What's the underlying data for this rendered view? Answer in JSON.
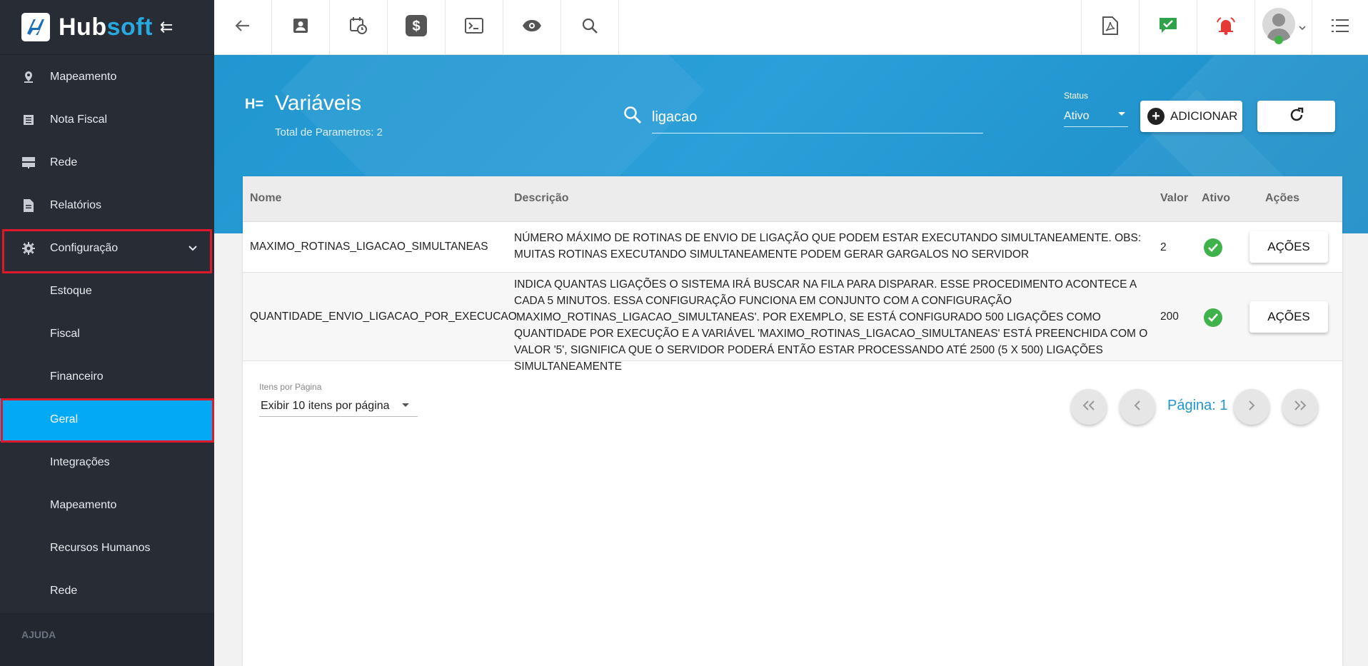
{
  "brand": {
    "name_part1": "Hub",
    "name_part2": "soft"
  },
  "sidebar": {
    "items": [
      {
        "label": "Mapeamento",
        "icon": "map-pin-icon"
      },
      {
        "label": "Nota Fiscal",
        "icon": "receipt-icon"
      },
      {
        "label": "Rede",
        "icon": "server-icon"
      },
      {
        "label": "Relatórios",
        "icon": "document-icon"
      },
      {
        "label": "Configuração",
        "icon": "gear-icon"
      }
    ],
    "subitems": [
      {
        "label": "Estoque"
      },
      {
        "label": "Fiscal"
      },
      {
        "label": "Financeiro"
      },
      {
        "label": "Geral"
      },
      {
        "label": "Integrações"
      },
      {
        "label": "Mapeamento"
      },
      {
        "label": "Recursos Humanos"
      },
      {
        "label": "Rede"
      }
    ],
    "help_label": "AJUDA"
  },
  "page": {
    "title": "Variáveis",
    "subtitle": "Total de Parametros: 2"
  },
  "search": {
    "value": "ligacao"
  },
  "status": {
    "label": "Status",
    "value": "Ativo"
  },
  "buttons": {
    "add": "ADICIONAR"
  },
  "table": {
    "headers": {
      "nome": "Nome",
      "descricao": "Descrição",
      "valor": "Valor",
      "ativo": "Ativo",
      "acoes": "Ações"
    },
    "rows": [
      {
        "nome": "MAXIMO_ROTINAS_LIGACAO_SIMULTANEAS",
        "descricao": "NÚMERO MÁXIMO DE ROTINAS DE ENVIO DE LIGAÇÃO QUE PODEM ESTAR EXECUTANDO SIMULTANEAMENTE. OBS: MUITAS ROTINAS EXECUTANDO SIMULTANEAMENTE PODEM GERAR GARGALOS NO SERVIDOR",
        "valor": "2",
        "acao": "AÇÕES"
      },
      {
        "nome": "QUANTIDADE_ENVIO_LIGACAO_POR_EXECUCAO",
        "descricao": "INDICA QUANTAS LIGAÇÕES O SISTEMA IRÁ BUSCAR NA FILA PARA DISPARAR. ESSE PROCEDIMENTO ACONTECE A CADA 5 MINUTOS. ESSA CONFIGURAÇÃO FUNCIONA EM CONJUNTO COM A CONFIGURAÇÃO 'MAXIMO_ROTINAS_LIGACAO_SIMULTANEAS'. POR EXEMPLO, SE ESTÁ CONFIGURADO 500 LIGAÇÕES COMO QUANTIDADE POR EXECUÇÃO E A VARIÁVEL 'MAXIMO_ROTINAS_LIGACAO_SIMULTANEAS' ESTÁ PREENCHIDA COM O VALOR '5', SIGNIFICA QUE O SERVIDOR PODERÁ ENTÃO ESTAR PROCESSANDO ATÉ 2500 (5 X 500) LIGAÇÕES SIMULTANEAMENTE",
        "valor": "200",
        "acao": "AÇÕES"
      }
    ]
  },
  "pagination": {
    "items_per_page_label": "Itens por Página",
    "items_per_page_value": "Exibir 10 itens por página",
    "page_label": "Página: 1"
  },
  "colors": {
    "accent": "#03a9f4",
    "band": "#2196cf",
    "sidebar": "#272c35",
    "highlight": "#e0182b",
    "success": "#3fb24b"
  }
}
